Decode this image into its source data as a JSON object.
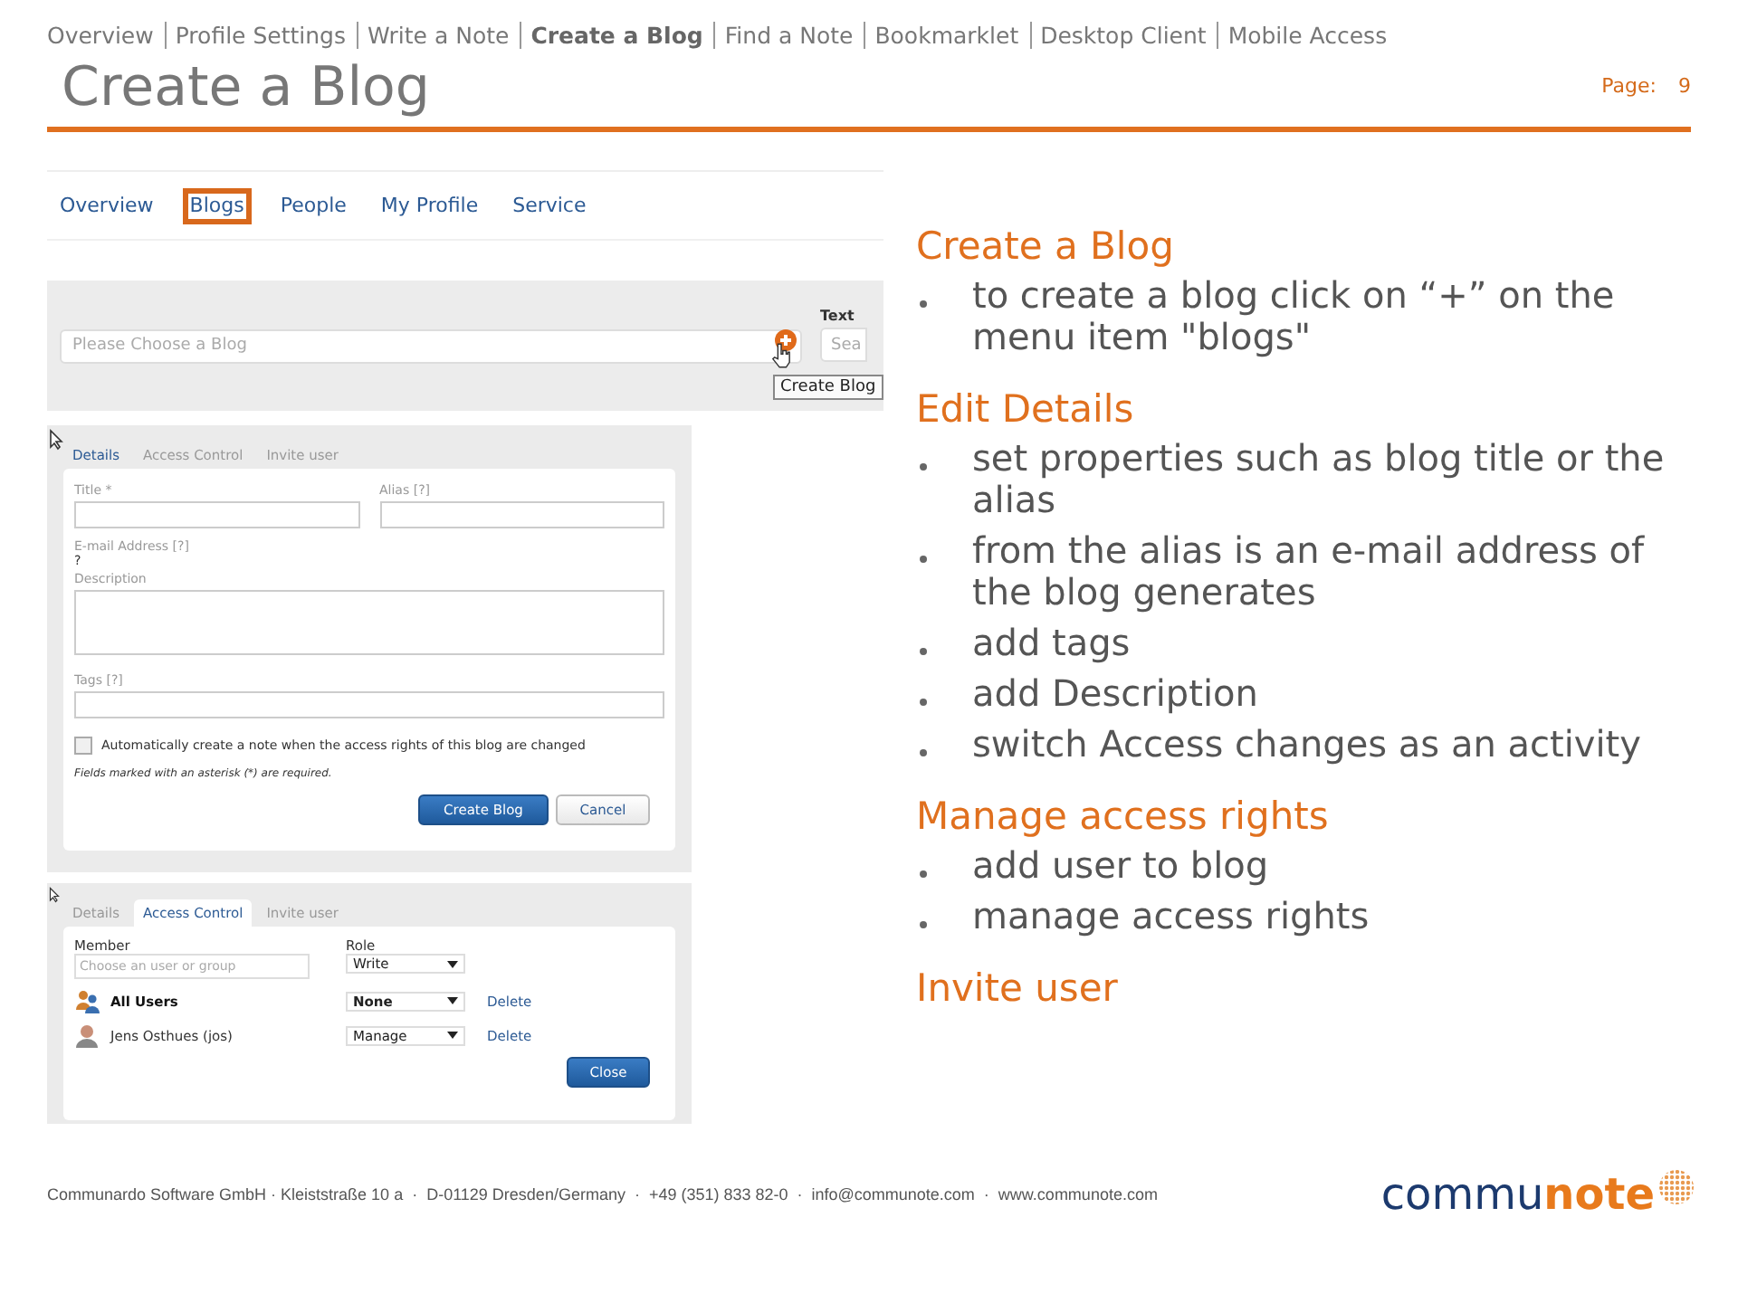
{
  "nav": [
    {
      "label": "Overview",
      "selected": false
    },
    {
      "label": "Profile Settings",
      "selected": false
    },
    {
      "label": "Write a Note",
      "selected": false
    },
    {
      "label": "Create a Blog",
      "selected": true
    },
    {
      "label": "Find a Note",
      "selected": false
    },
    {
      "label": "Bookmarklet",
      "selected": false
    },
    {
      "label": "Desktop Client",
      "selected": false
    },
    {
      "label": "Mobile Access",
      "selected": false
    }
  ],
  "title": "Create a Blog",
  "page_label": "Page:",
  "page_number": "9",
  "app_screenshot": {
    "tabs": [
      {
        "label": "Overview",
        "selected": false
      },
      {
        "label": "Blogs",
        "selected": true
      },
      {
        "label": "People",
        "selected": false
      },
      {
        "label": "My Profile",
        "selected": false
      },
      {
        "label": "Service",
        "selected": false
      }
    ],
    "blog_field": {
      "placeholder": "Please Choose a Blog"
    },
    "text_label": "Text",
    "search_field": {
      "placeholder": "Sea"
    },
    "tooltip": "Create Blog"
  },
  "details_dialog": {
    "tabs": [
      {
        "label": "Details",
        "selected": true
      },
      {
        "label": "Access Control",
        "selected": false
      },
      {
        "label": "Invite user",
        "selected": false
      }
    ],
    "title_label": "Title *",
    "alias_label": "Alias [?]",
    "email_label": "E-mail Address [?]",
    "email_value": "?",
    "description_label": "Description",
    "tags_label": "Tags [?]",
    "checkbox": {
      "label": "Automatically create a note when the access rights of this blog are changed",
      "checked": false
    },
    "required_note": "Fields marked with an asterisk (*) are required.",
    "buttons": [
      {
        "label": "Create Blog",
        "kind": "primary"
      },
      {
        "label": "Cancel",
        "kind": "secondary"
      }
    ]
  },
  "access_dialog": {
    "tabs": [
      {
        "label": "Details",
        "selected": false
      },
      {
        "label": "Access Control",
        "selected": true
      },
      {
        "label": "Invite user",
        "selected": false
      }
    ],
    "member_label": "Member",
    "role_label": "Role",
    "member_field": {
      "placeholder": "Choose an user or group"
    },
    "role_field": {
      "value": "Write"
    },
    "members": [
      {
        "name": "All Users",
        "kind": "group",
        "role": "None",
        "action": "Delete"
      },
      {
        "name": "Jens Osthues (jos)",
        "kind": "user",
        "role": "Manage",
        "action": "Delete"
      }
    ],
    "close_button": "Close"
  },
  "sections": [
    {
      "heading": "Create a Blog",
      "bullets": [
        "to create a blog click on “+” on the menu item \"blogs\""
      ]
    },
    {
      "heading": "Edit Details",
      "bullets": [
        "set properties such as blog title or the alias",
        "from the alias is an e-mail address of the blog generates",
        "add tags",
        "add Description",
        "switch Access changes as an activity"
      ]
    },
    {
      "heading": "Manage access rights",
      "bullets": [
        "add user to blog",
        "manage access rights"
      ]
    },
    {
      "heading": "Invite user"
    }
  ],
  "footer": "Communardo Software GmbH · Kleiststraße 10 a  ·  D-01129 Dresden/Germany  ·  +49 (351) 833 82-0  ·  info@communote.com  ·  www.communote.com",
  "logo": {
    "part_1": "commu",
    "part_2": "note"
  }
}
